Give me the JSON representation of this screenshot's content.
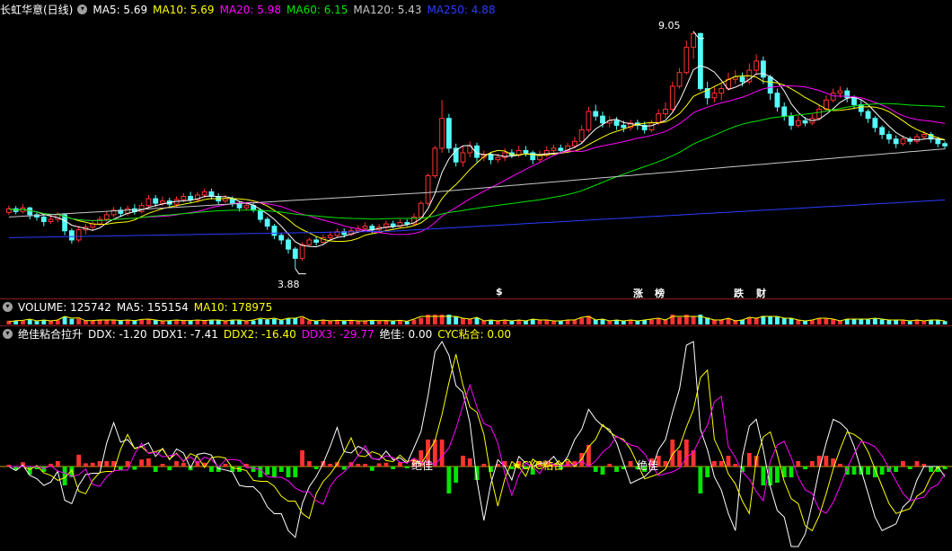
{
  "colors": {
    "bg": "#000000",
    "up": "#ff3232",
    "down": "#54fcfc",
    "ma5": "#ffffff",
    "ma10": "#ffff00",
    "ma20": "#ff00ff",
    "ma60": "#00e600",
    "ma120": "#c8c8c8",
    "ma250": "#2a3cff",
    "panel_sep": "#8b1a1a"
  },
  "header": {
    "title": "长虹华意(日线)",
    "ma5": "MA5: 5.69",
    "ma10": "MA10: 5.69",
    "ma20": "MA20: 5.98",
    "ma60": "MA60: 6.15",
    "ma120": "MA120: 5.43",
    "ma250": "MA250: 4.88"
  },
  "price_labels": {
    "high": "9.05",
    "low": "3.88"
  },
  "events": [
    {
      "label": "$",
      "color": "#ff3232"
    },
    {
      "label": "涨",
      "color": "#ff3232"
    },
    {
      "label": "榜",
      "color": "#ff9933"
    },
    {
      "label": "跌",
      "color": "#00e600"
    },
    {
      "label": "财",
      "color": "#54a8ff"
    }
  ],
  "volume_header": {
    "title": "VOLUME: 125742",
    "ma5": "MA5: 155154",
    "ma10": "MA10: 178975"
  },
  "indicator_header": {
    "title": "绝佳粘合拉升",
    "ddx": "DDX: -1.20",
    "ddx1": "DDX1: -7.41",
    "ddx2": "DDX2: -16.40",
    "ddx3": "DDX3: -29.77",
    "jue": "绝佳: 0.00",
    "cyc": "CYC粘合: 0.00"
  },
  "indicator_labels": [
    "绝佳",
    "★CYC粘合",
    "绝佳"
  ],
  "chart_data": {
    "type": "candlestick",
    "price_range": [
      3.5,
      9.3
    ],
    "candles": [
      [
        5.1,
        5.18,
        5.25,
        5.05
      ],
      [
        5.18,
        5.12,
        5.24,
        5.06
      ],
      [
        5.12,
        5.2,
        5.28,
        5.08
      ],
      [
        5.2,
        5.05,
        5.22,
        4.95
      ],
      [
        5.05,
        5.0,
        5.1,
        4.92
      ],
      [
        5.0,
        4.9,
        5.05,
        4.8
      ],
      [
        4.9,
        4.95,
        5.05,
        4.85
      ],
      [
        4.95,
        5.05,
        5.1,
        4.88
      ],
      [
        5.05,
        4.7,
        5.08,
        4.6
      ],
      [
        4.7,
        4.5,
        4.75,
        4.42
      ],
      [
        4.5,
        4.72,
        4.8,
        4.45
      ],
      [
        4.72,
        4.78,
        4.85,
        4.62
      ],
      [
        4.78,
        4.85,
        4.92,
        4.7
      ],
      [
        4.85,
        4.95,
        5.02,
        4.8
      ],
      [
        4.95,
        5.05,
        5.12,
        4.9
      ],
      [
        5.05,
        5.15,
        5.22,
        5.0
      ],
      [
        5.15,
        5.08,
        5.22,
        5.0
      ],
      [
        5.08,
        5.18,
        5.25,
        5.02
      ],
      [
        5.18,
        5.12,
        5.28,
        5.05
      ],
      [
        5.12,
        5.25,
        5.32,
        5.08
      ],
      [
        5.25,
        5.4,
        5.48,
        5.2
      ],
      [
        5.4,
        5.3,
        5.48,
        5.22
      ],
      [
        5.3,
        5.35,
        5.45,
        5.25
      ],
      [
        5.35,
        5.28,
        5.42,
        5.2
      ],
      [
        5.28,
        5.38,
        5.45,
        5.22
      ],
      [
        5.38,
        5.45,
        5.52,
        5.32
      ],
      [
        5.45,
        5.38,
        5.55,
        5.3
      ],
      [
        5.38,
        5.48,
        5.55,
        5.32
      ],
      [
        5.48,
        5.55,
        5.62,
        5.42
      ],
      [
        5.55,
        5.45,
        5.62,
        5.38
      ],
      [
        5.45,
        5.35,
        5.52,
        5.28
      ],
      [
        5.35,
        5.4,
        5.48,
        5.3
      ],
      [
        5.4,
        5.3,
        5.45,
        5.22
      ],
      [
        5.3,
        5.2,
        5.35,
        5.12
      ],
      [
        5.2,
        5.25,
        5.32,
        5.15
      ],
      [
        5.25,
        5.15,
        5.3,
        5.1
      ],
      [
        5.15,
        4.95,
        5.18,
        4.88
      ],
      [
        4.95,
        4.8,
        5.0,
        4.72
      ],
      [
        4.8,
        4.6,
        4.85,
        4.52
      ],
      [
        4.6,
        4.5,
        4.65,
        4.4
      ],
      [
        4.5,
        4.3,
        4.55,
        4.2
      ],
      [
        4.3,
        4.1,
        4.35,
        3.88
      ],
      [
        4.1,
        4.4,
        4.45,
        4.05
      ],
      [
        4.4,
        4.5,
        4.55,
        4.35
      ],
      [
        4.5,
        4.45,
        4.58,
        4.38
      ],
      [
        4.45,
        4.55,
        4.62,
        4.4
      ],
      [
        4.55,
        4.6,
        4.68,
        4.5
      ],
      [
        4.6,
        4.68,
        4.75,
        4.55
      ],
      [
        4.68,
        4.62,
        4.75,
        4.55
      ],
      [
        4.62,
        4.7,
        4.78,
        4.58
      ],
      [
        4.7,
        4.75,
        4.82,
        4.65
      ],
      [
        4.75,
        4.8,
        4.88,
        4.7
      ],
      [
        4.8,
        4.72,
        4.85,
        4.65
      ],
      [
        4.72,
        4.78,
        4.85,
        4.68
      ],
      [
        4.78,
        4.85,
        4.92,
        4.72
      ],
      [
        4.85,
        4.8,
        4.92,
        4.75
      ],
      [
        4.8,
        4.88,
        4.95,
        4.75
      ],
      [
        4.88,
        4.85,
        4.95,
        4.8
      ],
      [
        4.85,
        5.0,
        5.08,
        4.82
      ],
      [
        5.0,
        5.3,
        5.35,
        4.98
      ],
      [
        5.3,
        5.9,
        5.95,
        5.25
      ],
      [
        5.9,
        6.5,
        6.55,
        5.85
      ],
      [
        6.5,
        7.15,
        7.55,
        6.4
      ],
      [
        7.15,
        6.5,
        7.25,
        6.4
      ],
      [
        6.5,
        6.2,
        6.6,
        6.1
      ],
      [
        6.2,
        6.4,
        6.55,
        6.1
      ],
      [
        6.4,
        6.55,
        6.65,
        6.3
      ],
      [
        6.55,
        6.3,
        6.62,
        6.2
      ],
      [
        6.3,
        6.35,
        6.45,
        6.22
      ],
      [
        6.35,
        6.25,
        6.42,
        6.15
      ],
      [
        6.25,
        6.3,
        6.38,
        6.18
      ],
      [
        6.3,
        6.4,
        6.5,
        6.22
      ],
      [
        6.4,
        6.35,
        6.48,
        6.28
      ],
      [
        6.35,
        6.45,
        6.55,
        6.3
      ],
      [
        6.45,
        6.4,
        6.55,
        6.32
      ],
      [
        6.4,
        6.25,
        6.45,
        6.15
      ],
      [
        6.25,
        6.35,
        6.45,
        6.2
      ],
      [
        6.35,
        6.45,
        6.55,
        6.3
      ],
      [
        6.45,
        6.5,
        6.58,
        6.4
      ],
      [
        6.5,
        6.45,
        6.58,
        6.38
      ],
      [
        6.45,
        6.55,
        6.62,
        6.4
      ],
      [
        6.55,
        6.65,
        6.75,
        6.5
      ],
      [
        6.65,
        6.9,
        7.0,
        6.6
      ],
      [
        6.9,
        7.3,
        7.4,
        6.85
      ],
      [
        7.3,
        7.2,
        7.45,
        7.1
      ],
      [
        7.2,
        7.05,
        7.3,
        6.95
      ],
      [
        7.05,
        7.1,
        7.2,
        6.95
      ],
      [
        7.1,
        7.0,
        7.18,
        6.9
      ],
      [
        7.0,
        6.95,
        7.1,
        6.85
      ],
      [
        6.95,
        7.05,
        7.12,
        6.88
      ],
      [
        7.05,
        7.0,
        7.12,
        6.9
      ],
      [
        7.0,
        6.9,
        7.08,
        6.82
      ],
      [
        6.9,
        7.05,
        7.12,
        6.85
      ],
      [
        7.05,
        7.25,
        7.35,
        7.0
      ],
      [
        7.25,
        7.35,
        7.5,
        7.15
      ],
      [
        7.35,
        7.85,
        7.95,
        7.3
      ],
      [
        7.85,
        8.15,
        8.25,
        7.8
      ],
      [
        8.15,
        8.7,
        8.85,
        8.1
      ],
      [
        8.7,
        9.0,
        9.05,
        8.45
      ],
      [
        9.0,
        7.8,
        9.02,
        7.75
      ],
      [
        7.8,
        7.6,
        7.95,
        7.45
      ],
      [
        7.6,
        7.7,
        7.85,
        7.5
      ],
      [
        7.7,
        7.8,
        7.9,
        7.55
      ],
      [
        7.8,
        8.0,
        8.15,
        7.75
      ],
      [
        8.0,
        8.05,
        8.2,
        7.9
      ],
      [
        8.05,
        7.95,
        8.15,
        7.85
      ],
      [
        7.95,
        8.2,
        8.35,
        7.9
      ],
      [
        8.2,
        8.4,
        8.55,
        8.1
      ],
      [
        8.4,
        8.05,
        8.5,
        7.9
      ],
      [
        8.05,
        7.7,
        8.1,
        7.55
      ],
      [
        7.7,
        7.4,
        7.8,
        7.3
      ],
      [
        7.4,
        7.2,
        7.5,
        7.1
      ],
      [
        7.2,
        7.0,
        7.28,
        6.9
      ],
      [
        7.0,
        7.1,
        7.2,
        6.95
      ],
      [
        7.1,
        7.05,
        7.18,
        6.98
      ],
      [
        7.05,
        7.15,
        7.25,
        7.0
      ],
      [
        7.15,
        7.35,
        7.45,
        7.1
      ],
      [
        7.35,
        7.55,
        7.65,
        7.3
      ],
      [
        7.55,
        7.7,
        7.8,
        7.5
      ],
      [
        7.7,
        7.75,
        7.85,
        7.6
      ],
      [
        7.75,
        7.6,
        7.82,
        7.5
      ],
      [
        7.6,
        7.45,
        7.65,
        7.35
      ],
      [
        7.45,
        7.3,
        7.55,
        7.2
      ],
      [
        7.3,
        7.15,
        7.35,
        7.05
      ],
      [
        7.15,
        6.95,
        7.2,
        6.85
      ],
      [
        6.95,
        6.8,
        7.0,
        6.7
      ],
      [
        6.8,
        6.7,
        6.88,
        6.6
      ],
      [
        6.7,
        6.6,
        6.78,
        6.5
      ],
      [
        6.6,
        6.7,
        6.78,
        6.55
      ],
      [
        6.7,
        6.65,
        6.75,
        6.58
      ],
      [
        6.65,
        6.75,
        6.82,
        6.6
      ],
      [
        6.75,
        6.8,
        6.88,
        6.7
      ],
      [
        6.8,
        6.7,
        6.85,
        6.62
      ],
      [
        6.7,
        6.6,
        6.75,
        6.52
      ],
      [
        6.6,
        6.55,
        6.65,
        6.48
      ]
    ],
    "ma_series": [
      "MA5",
      "MA10",
      "MA20",
      "MA60",
      "MA120",
      "MA250"
    ]
  }
}
